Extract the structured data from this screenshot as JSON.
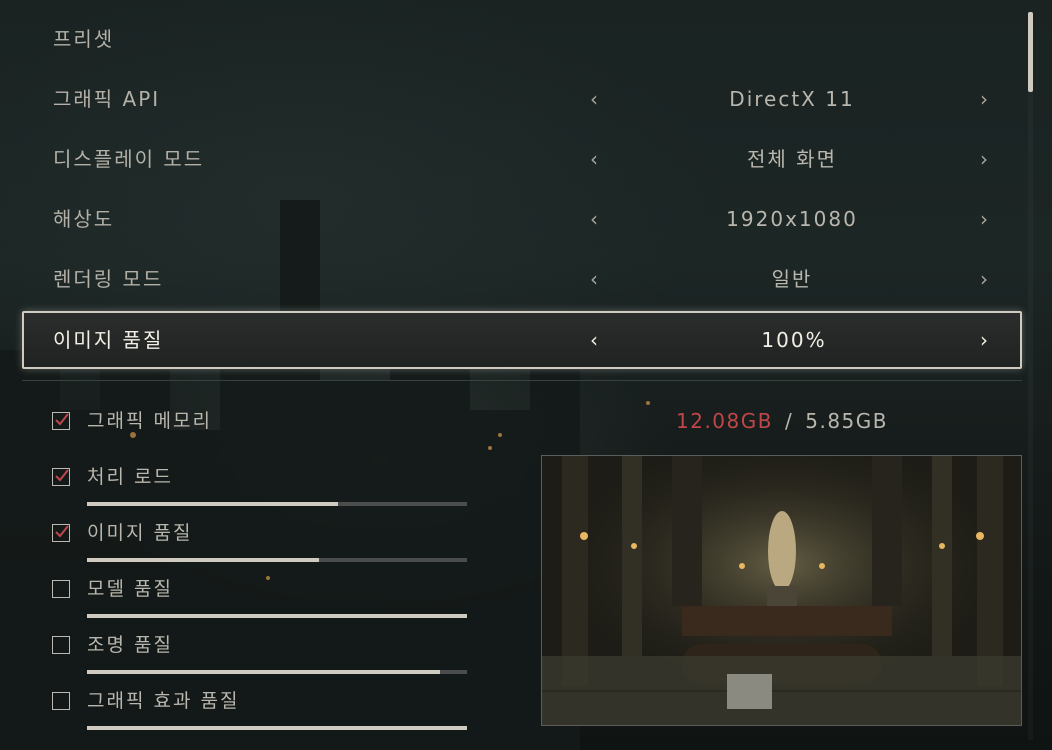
{
  "settings": {
    "preset_label": "프리셋",
    "rows": [
      {
        "label": "그래픽 API",
        "value": "DirectX 11"
      },
      {
        "label": "디스플레이 모드",
        "value": "전체 화면"
      },
      {
        "label": "해상도",
        "value": "1920x1080"
      },
      {
        "label": "렌더링 모드",
        "value": "일반"
      },
      {
        "label": "이미지 품질",
        "value": "100%"
      }
    ],
    "arrow_left": "‹",
    "arrow_right": "›"
  },
  "memory": {
    "label": "그래픽 메모리",
    "used": "12.08GB",
    "separator": "/",
    "total": "5.85GB",
    "used_color": "#c0464a"
  },
  "load_items": [
    {
      "label": "처리 로드",
      "checked": true,
      "level": 0.66
    },
    {
      "label": "이미지 품질",
      "checked": true,
      "level": 0.61
    },
    {
      "label": "모델 품질",
      "checked": false,
      "level": 1.0
    },
    {
      "label": "조명 품질",
      "checked": false,
      "level": 0.93
    },
    {
      "label": "그래픽 효과 품질",
      "checked": false,
      "level": 1.0
    }
  ],
  "colors": {
    "accent": "#cfcbc1",
    "text": "#b9b6ad",
    "selected_text": "#f2efe6",
    "check_mark": "#c0464a"
  },
  "icons": {
    "left": "chevron-left-icon",
    "right": "chevron-right-icon",
    "check": "checkmark-icon"
  }
}
